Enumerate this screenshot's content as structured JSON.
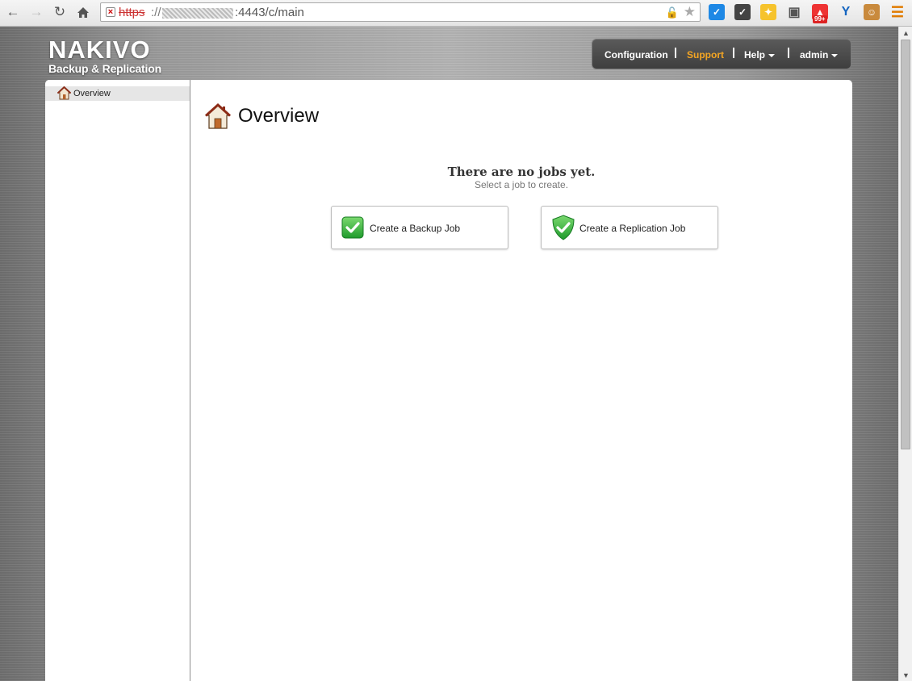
{
  "browser": {
    "url_scheme": "https",
    "url_separator": "://",
    "url_rest": ":4443/c/main",
    "extension_badge": "99+"
  },
  "app": {
    "logo_main": "NAKIVO",
    "logo_sub": "Backup & Replication",
    "menu": {
      "configuration": "Configuration",
      "support": "Support",
      "help": "Help",
      "user": "admin"
    },
    "colors": {
      "support_accent": "#f5a623"
    }
  },
  "sidebar": {
    "items": [
      {
        "label": "Overview",
        "icon": "home-icon"
      }
    ]
  },
  "main": {
    "title": "Overview",
    "empty_title": "There are no jobs yet.",
    "empty_subtitle": "Select a job to create.",
    "actions": {
      "backup": {
        "label": "Create a Backup Job",
        "icon": "check-square-icon"
      },
      "replication": {
        "label": "Create a Replication Job",
        "icon": "check-shield-icon"
      }
    }
  }
}
